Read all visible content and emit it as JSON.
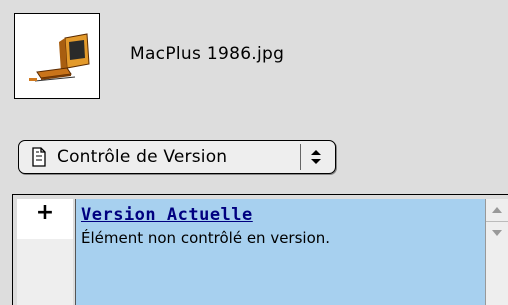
{
  "file": {
    "icon": "macplus-computer-icon",
    "name": "MacPlus 1986.jpg"
  },
  "popup": {
    "icon": "document-icon",
    "label": "Contrôle de Version",
    "arrows_icon": "popup-arrows-icon"
  },
  "version_list": {
    "expander": "+",
    "rows": [
      {
        "title": "Version Actuelle",
        "description": "Élément non contrôlé en version."
      }
    ]
  },
  "scrollbar": {
    "up_icon": "scroll-up-arrow-icon",
    "down_icon": "scroll-down-arrow-icon"
  },
  "colors": {
    "window_bg": "#dddddd",
    "selection": "#a7d0ef",
    "link_title": "#000080"
  }
}
